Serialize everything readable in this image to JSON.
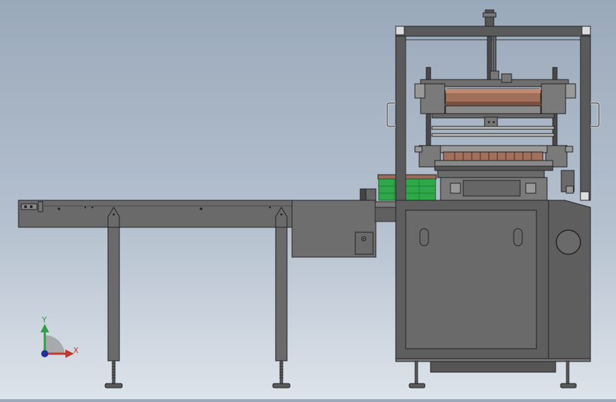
{
  "triad": {
    "y_label": "Y",
    "x_label": "X",
    "y_color": "#2ea043",
    "x_color": "#c0392b",
    "z_color": "#1f2f9e"
  },
  "colors": {
    "frame": "#5c5c5c",
    "frame_dark": "#3a3a3a",
    "outline": "#222222",
    "roller": "#a0705a",
    "product_box": "#2fa84a",
    "conveyor": "#6b6b6b"
  }
}
